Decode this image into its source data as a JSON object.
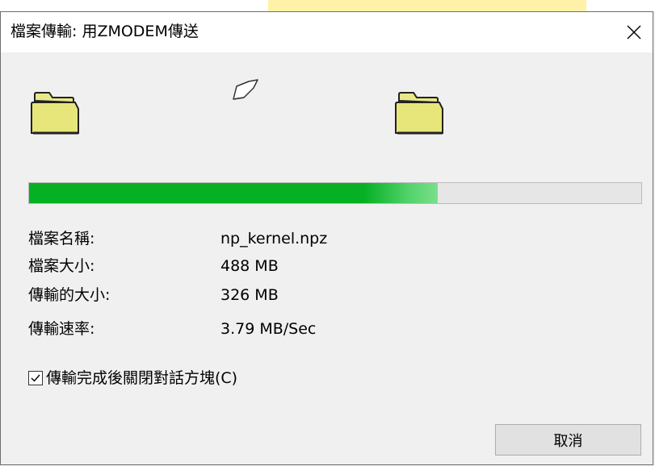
{
  "window": {
    "title": "檔案傳輸: 用ZMODEM傳送",
    "close_icon": "close-icon"
  },
  "transfer": {
    "source_icon": "folder-icon",
    "flying_icon": "paper-icon",
    "destination_icon": "folder-icon",
    "progress_fraction": 0.668,
    "progress_color": "#06b025"
  },
  "info": [
    {
      "label": "檔案名稱:",
      "value": "np_kernel.npz"
    },
    {
      "label": "檔案大小:",
      "value": "488 MB"
    },
    {
      "label": "傳輸的大小:",
      "value": "326 MB"
    },
    {
      "label": "傳輸速率:",
      "value": "3.79 MB/Sec"
    }
  ],
  "options": {
    "close_on_complete_label": "傳輸完成後關閉對話方塊(C)",
    "close_on_complete_checked": true
  },
  "buttons": {
    "cancel_label": "取消"
  },
  "colors": {
    "background_highlight": "#fff2a8"
  }
}
